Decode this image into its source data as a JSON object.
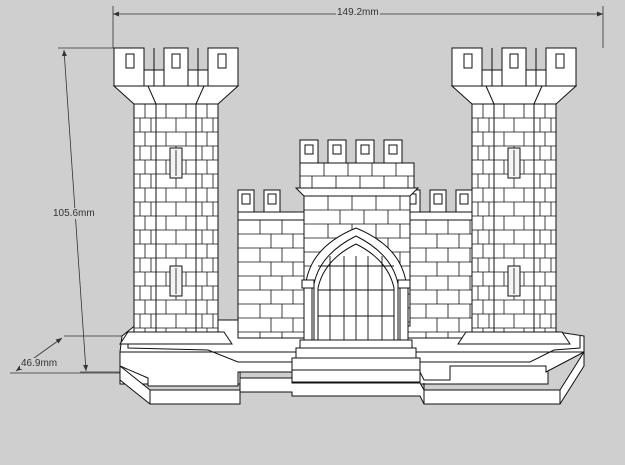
{
  "dimensions": {
    "width": "149.2mm",
    "height": "105.6mm",
    "depth": "46.9mm"
  },
  "colors": {
    "background": "#cfcfcf",
    "face": "#ffffff",
    "line": "#111111",
    "dimension_line": "#333333"
  }
}
